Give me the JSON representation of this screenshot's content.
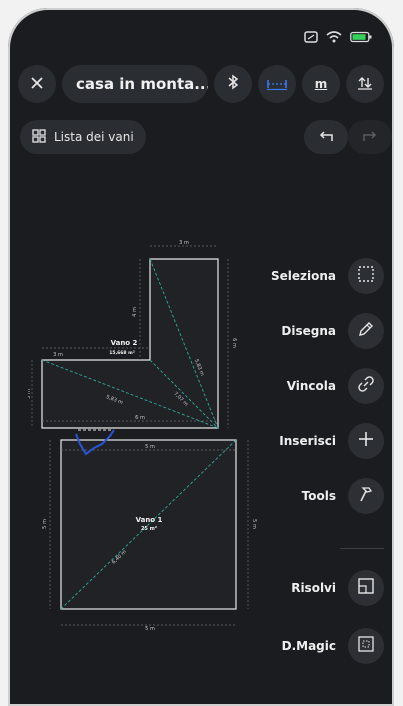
{
  "header": {
    "title": "casa in monta...",
    "units": {
      "dimension_icon": "dimension-line-icon",
      "meters_label": "m",
      "sort_icon": "sort-arrows-icon"
    }
  },
  "toolbar": {
    "rooms_list_label": "Lista dei vani"
  },
  "tools": [
    {
      "label": "Seleziona",
      "icon": "select-dotted-square-icon"
    },
    {
      "label": "Disegna",
      "icon": "pencil-icon"
    },
    {
      "label": "Vincola",
      "icon": "link-icon"
    },
    {
      "label": "Inserisci",
      "icon": "plus-icon"
    },
    {
      "label": "Tools",
      "icon": "hammer-icon"
    },
    {
      "label": "Risolvi",
      "icon": "resolve-square-icon"
    },
    {
      "label": "D.Magic",
      "icon": "magic-square-icon"
    }
  ],
  "plan": {
    "room2": {
      "name": "Vano 2",
      "area": "15,668 m²"
    },
    "room1": {
      "name": "Vano 1",
      "area": "25 m²"
    },
    "dims": {
      "top": "3 m",
      "left_wing_top": "3 m",
      "room2_bottom": "6 m",
      "room1_top": "5 m",
      "room1_bottom": "5 m",
      "left_side": "5 m",
      "right_side": "5 m",
      "tower_left": "4 m",
      "tower_right": "6 m",
      "diag1": "5,83 m",
      "diag2": "7,07 m",
      "diag3": "5,83 m",
      "diag4": "6,40 m",
      "left_wing_side": "3 m"
    }
  },
  "colors": {
    "background": "#1a1c1f",
    "accent": "#3a7bff",
    "dim_line": "#2fa89a"
  }
}
